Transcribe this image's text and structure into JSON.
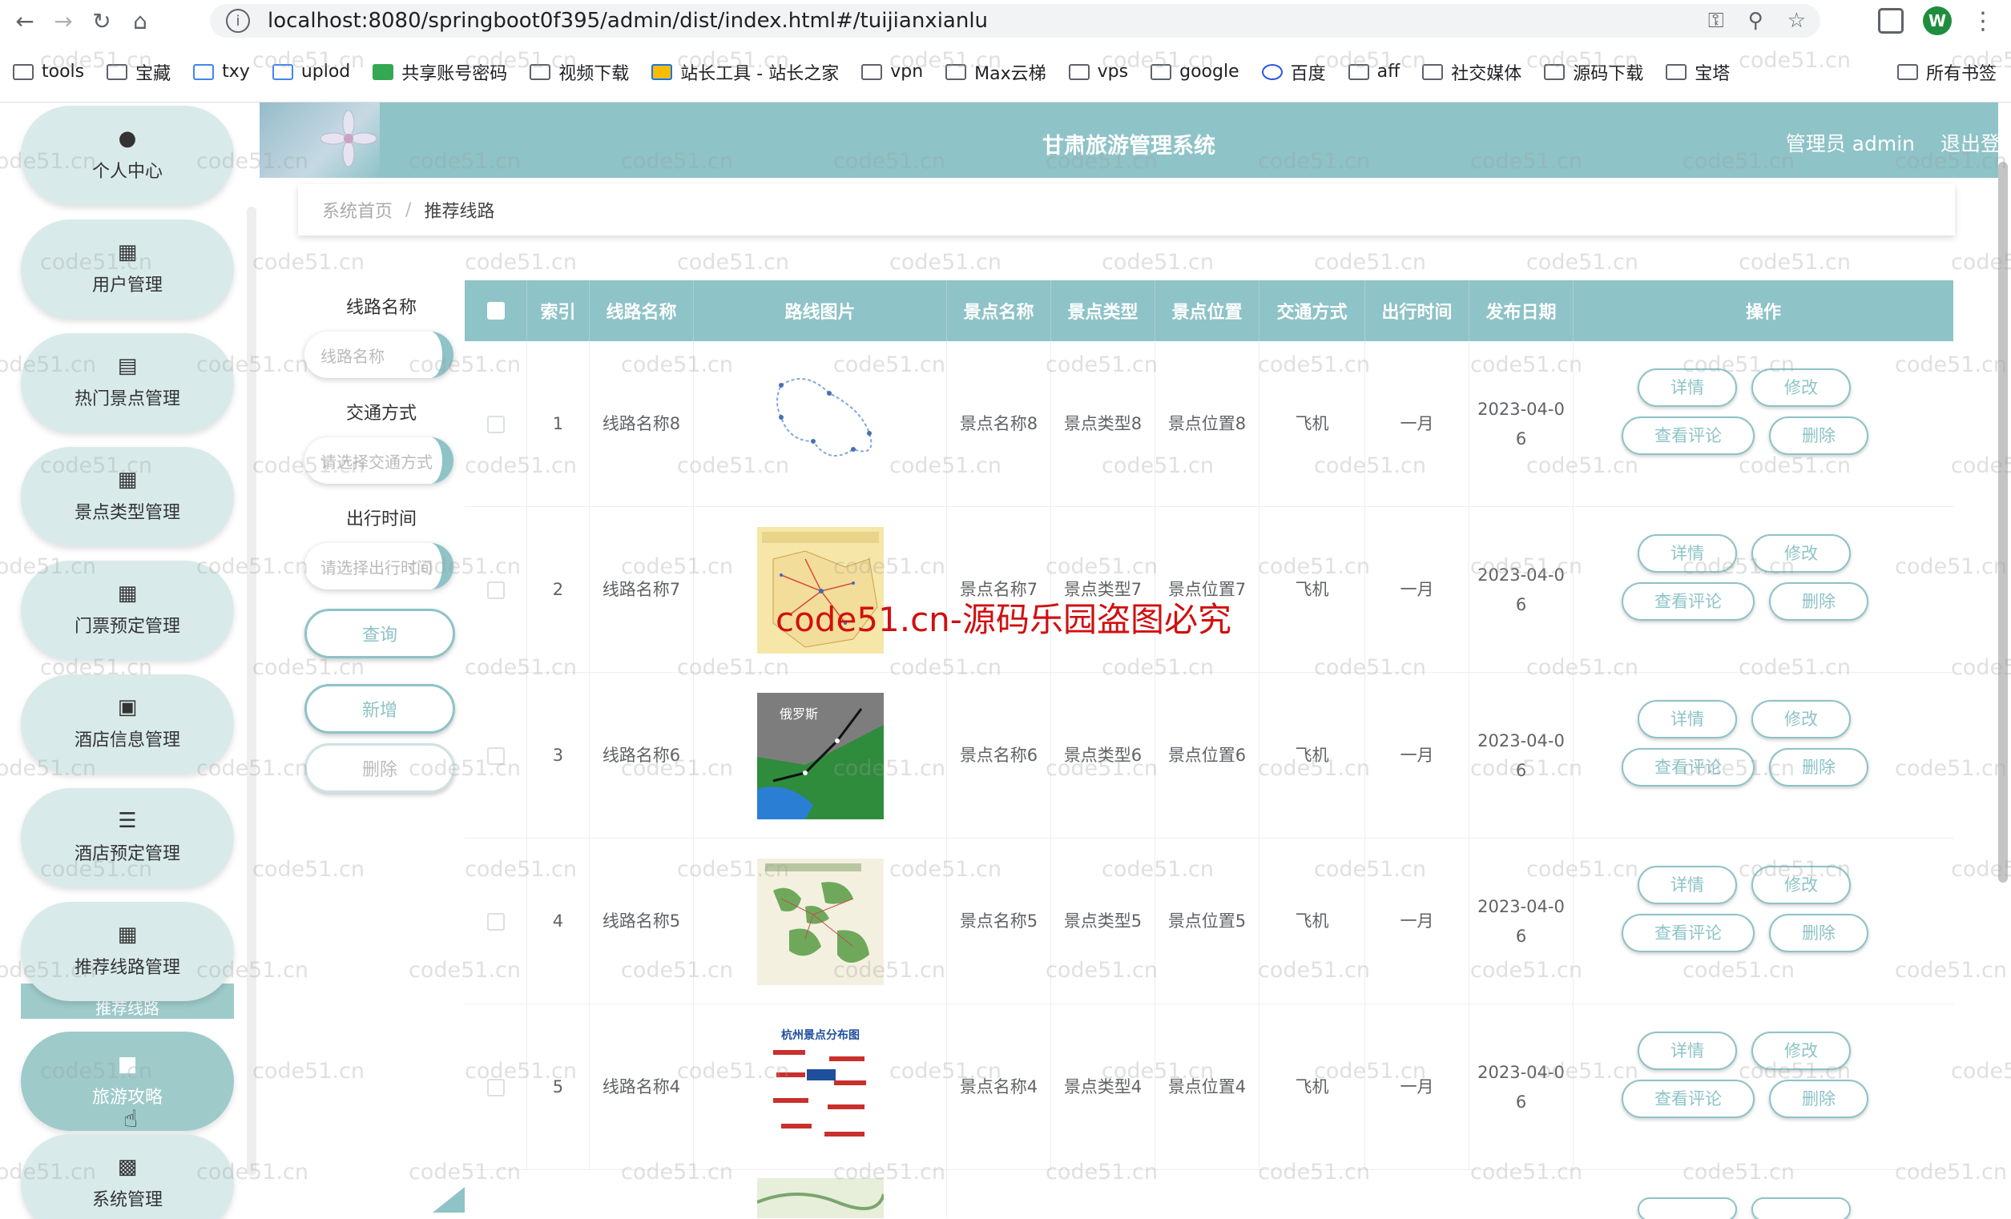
{
  "browser": {
    "url": "localhost:8080/springboot0f395/admin/dist/index.html#/tuijianxianlu",
    "profile_initial": "W",
    "bookmarks": [
      "tools",
      "宝藏",
      "txy",
      "uplod",
      "共享账号密码",
      "视频下载",
      "站长工具 - 站长之家",
      "vpn",
      "Max云梯",
      "vps",
      "google",
      "百度",
      "aff",
      "社交媒体",
      "源码下载",
      "宝塔"
    ],
    "all_bookmarks": "所有书签"
  },
  "app": {
    "title": "甘肃旅游管理系统",
    "user": "管理员 admin",
    "logout": "退出登录"
  },
  "sidebar": {
    "items": [
      {
        "label": "个人中心",
        "icon": "user-icon"
      },
      {
        "label": "用户管理",
        "icon": "grid-icon"
      },
      {
        "label": "热门景点管理",
        "icon": "clipboard-icon"
      },
      {
        "label": "景点类型管理",
        "icon": "grid-icon"
      },
      {
        "label": "门票预定管理",
        "icon": "grid-icon"
      },
      {
        "label": "酒店信息管理",
        "icon": "store-icon"
      },
      {
        "label": "酒店预定管理",
        "icon": "list-icon"
      },
      {
        "label": "推荐线路管理",
        "icon": "grid-icon"
      },
      {
        "label": "旅游攻略",
        "icon": "bag-icon"
      },
      {
        "label": "系统管理",
        "icon": "briefcase-icon"
      }
    ],
    "submenu": "推荐线路"
  },
  "breadcrumb": {
    "home": "系统首页",
    "sep": "/",
    "current": "推荐线路"
  },
  "search": {
    "route_label": "线路名称",
    "route_placeholder": "线路名称",
    "transport_label": "交通方式",
    "transport_placeholder": "请选择交通方式",
    "time_label": "出行时间",
    "time_placeholder": "请选择出行时间",
    "query_btn": "查询",
    "add_btn": "新增",
    "delete_btn": "删除"
  },
  "table": {
    "headers": [
      "索引",
      "线路名称",
      "路线图片",
      "景点名称",
      "景点类型",
      "景点位置",
      "交通方式",
      "出行时间",
      "发布日期",
      "操作"
    ],
    "rows": [
      {
        "index": "1",
        "name": "线路名称8",
        "spot": "景点名称8",
        "type": "景点类型8",
        "loc": "景点位置8",
        "transport": "飞机",
        "time": "一月",
        "date": "2023-04-06"
      },
      {
        "index": "2",
        "name": "线路名称7",
        "spot": "景点名称7",
        "type": "景点类型7",
        "loc": "景点位置7",
        "transport": "飞机",
        "time": "一月",
        "date": "2023-04-06"
      },
      {
        "index": "3",
        "name": "线路名称6",
        "spot": "景点名称6",
        "type": "景点类型6",
        "loc": "景点位置6",
        "transport": "飞机",
        "time": "一月",
        "date": "2023-04-06"
      },
      {
        "index": "4",
        "name": "线路名称5",
        "spot": "景点名称5",
        "type": "景点类型5",
        "loc": "景点位置5",
        "transport": "飞机",
        "time": "一月",
        "date": "2023-04-06"
      },
      {
        "index": "5",
        "name": "线路名称4",
        "spot": "景点名称4",
        "type": "景点类型4",
        "loc": "景点位置4",
        "transport": "飞机",
        "time": "一月",
        "date": "2023-04-06"
      }
    ],
    "actions": {
      "detail": "详情",
      "edit": "修改",
      "comments": "查看评论",
      "delete": "删除"
    },
    "image_labels": [
      "俄罗斯",
      "杭州景点分布图"
    ]
  },
  "watermark": {
    "text": "code51.cn",
    "red_text": "code51.cn-源码乐园盗图必究"
  },
  "colors": {
    "accent": "#8ec3c7",
    "sidebar_bg": "#d9eaea",
    "active": "#9ecaca"
  }
}
